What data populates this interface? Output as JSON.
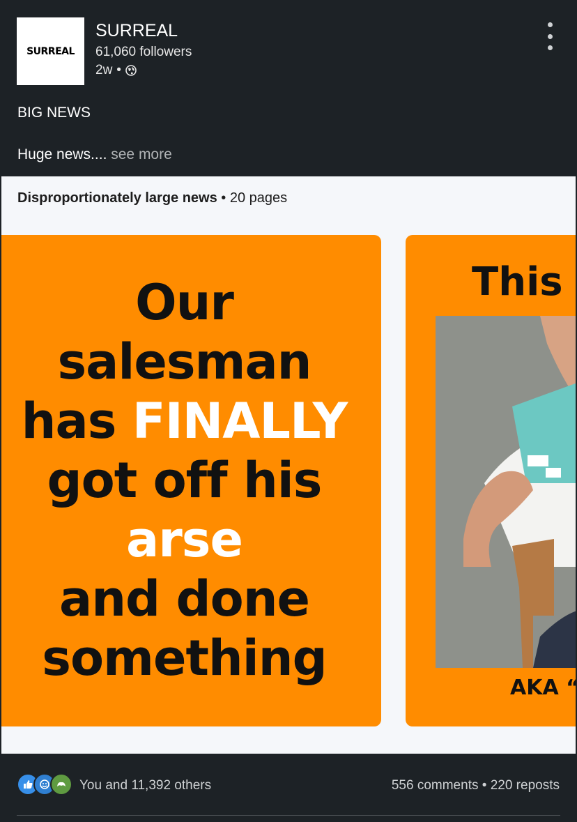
{
  "company": {
    "logo_text": "SURREAL",
    "name": "SURREAL",
    "followers": "61,060 followers",
    "time": "2w",
    "visibility_icon": "globe-icon"
  },
  "post": {
    "title": "BIG NEWS",
    "body": "Huge news....",
    "see_more": "see more"
  },
  "document": {
    "title": "Disproportionately large news",
    "pages": "20 pages",
    "slide1": {
      "line1": "Our",
      "line2": "salesman",
      "line3a": "has",
      "line3b": "FINALLY",
      "line4": "got off his",
      "line5": "arse",
      "line6": "and done",
      "line7": "something"
    },
    "slide2": {
      "title": "This",
      "caption": "AKA “"
    }
  },
  "engagement": {
    "reactions_text": "You and 11,392 others",
    "comments": "556 comments",
    "reposts": "220 reposts",
    "reaction_icons": [
      "like-icon",
      "celebrate-icon",
      "support-icon"
    ]
  },
  "colors": {
    "background": "#1d2226",
    "slide_orange": "#ff8c00",
    "document_bg": "#f5f7fa"
  }
}
